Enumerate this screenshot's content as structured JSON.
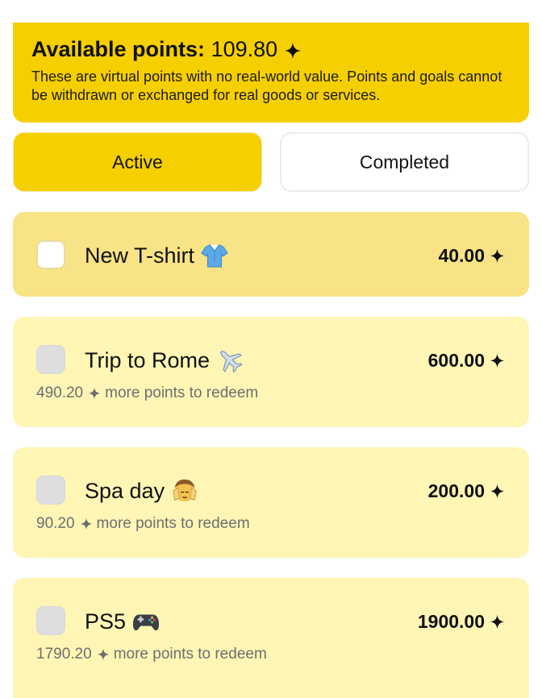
{
  "banner": {
    "points_label": "Available points:",
    "points_value": "109.80",
    "description": "These are virtual points with no real-world value. Points and goals cannot be withdrawn or exchanged for real goods or services."
  },
  "tabs": [
    {
      "label": "Active",
      "selected": true
    },
    {
      "label": "Completed",
      "selected": false
    }
  ],
  "goals": [
    {
      "name": "New T-shirt",
      "emoji": "t-shirt",
      "cost": "40.00",
      "remaining": "",
      "remaining_suffix": "",
      "checkbox_enabled": true,
      "highlighted": true
    },
    {
      "name": "Trip to Rome",
      "emoji": "airplane",
      "cost": "600.00",
      "remaining": "490.20",
      "remaining_suffix": "more points to redeem",
      "checkbox_enabled": false,
      "highlighted": false
    },
    {
      "name": "Spa day",
      "emoji": "face-massage",
      "cost": "200.00",
      "remaining": "90.20",
      "remaining_suffix": "more points to redeem",
      "checkbox_enabled": false,
      "highlighted": false
    },
    {
      "name": "PS5",
      "emoji": "video-game-controller",
      "cost": "1900.00",
      "remaining": "1790.20",
      "remaining_suffix": "more points to redeem",
      "checkbox_enabled": false,
      "highlighted": false
    }
  ],
  "colors": {
    "accent": "#f6cf00",
    "highlight_card": "#f8e387",
    "card": "#fff6b6",
    "muted_text": "#6e6e6e"
  }
}
